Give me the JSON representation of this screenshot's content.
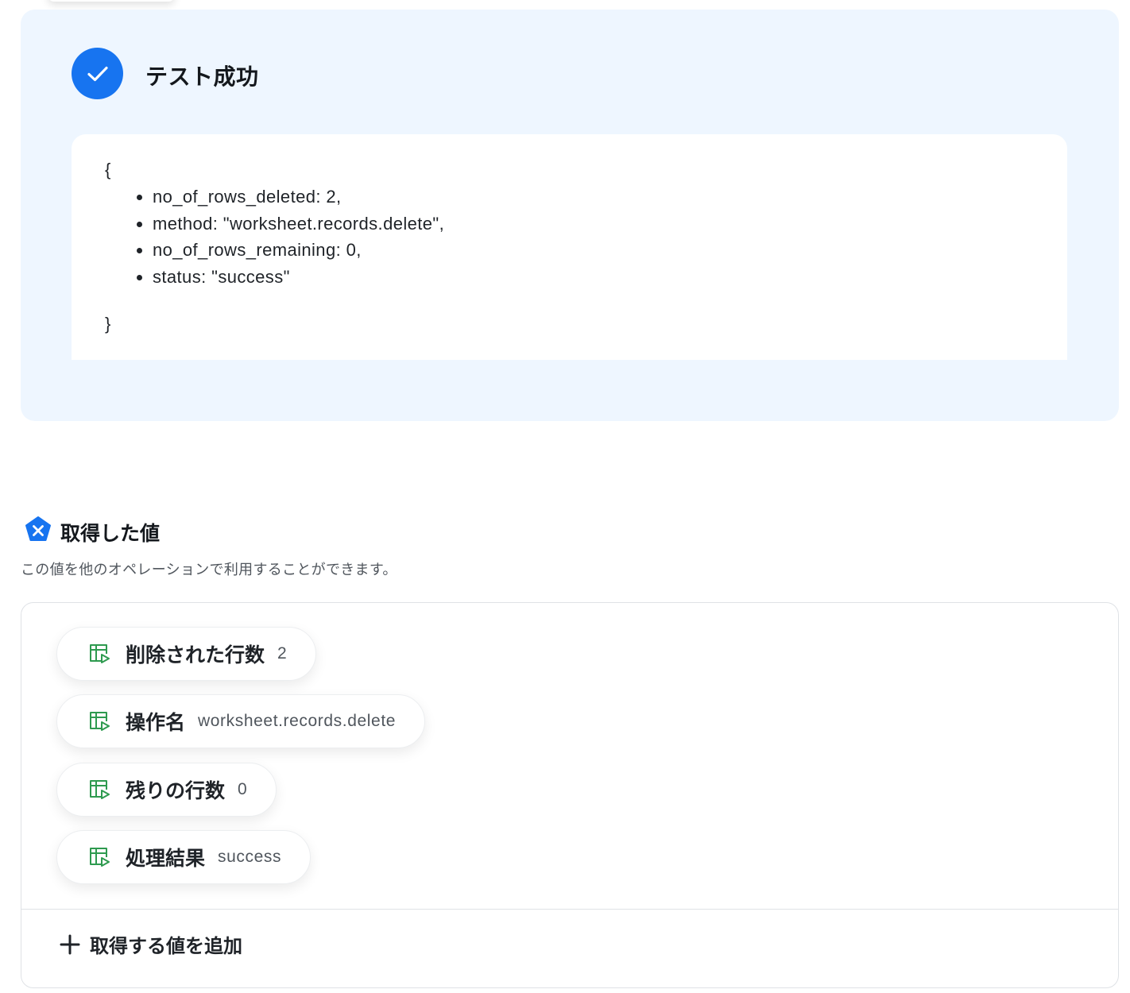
{
  "result": {
    "title": "テスト成功",
    "json_open": "{",
    "json_close": "}",
    "lines": [
      "no_of_rows_deleted: 2,",
      "method: \"worksheet.records.delete\",",
      "no_of_rows_remaining: 0,",
      "status: \"success\""
    ]
  },
  "values_section": {
    "title": "取得した値",
    "description": "この値を他のオペレーションで利用することができます。",
    "items": [
      {
        "label": "削除された行数",
        "value": "2"
      },
      {
        "label": "操作名",
        "value": "worksheet.records.delete"
      },
      {
        "label": "残りの行数",
        "value": "0"
      },
      {
        "label": "処理結果",
        "value": "success"
      }
    ],
    "add_label": "取得する値を追加"
  },
  "colors": {
    "accent": "#1774f0",
    "panel_bg": "#eef6ff",
    "sheet_icon": "#2e9a4f"
  },
  "icons": {
    "success": "check-icon",
    "section": "variable-x-icon",
    "item": "spreadsheet-icon",
    "add": "plus-icon"
  }
}
